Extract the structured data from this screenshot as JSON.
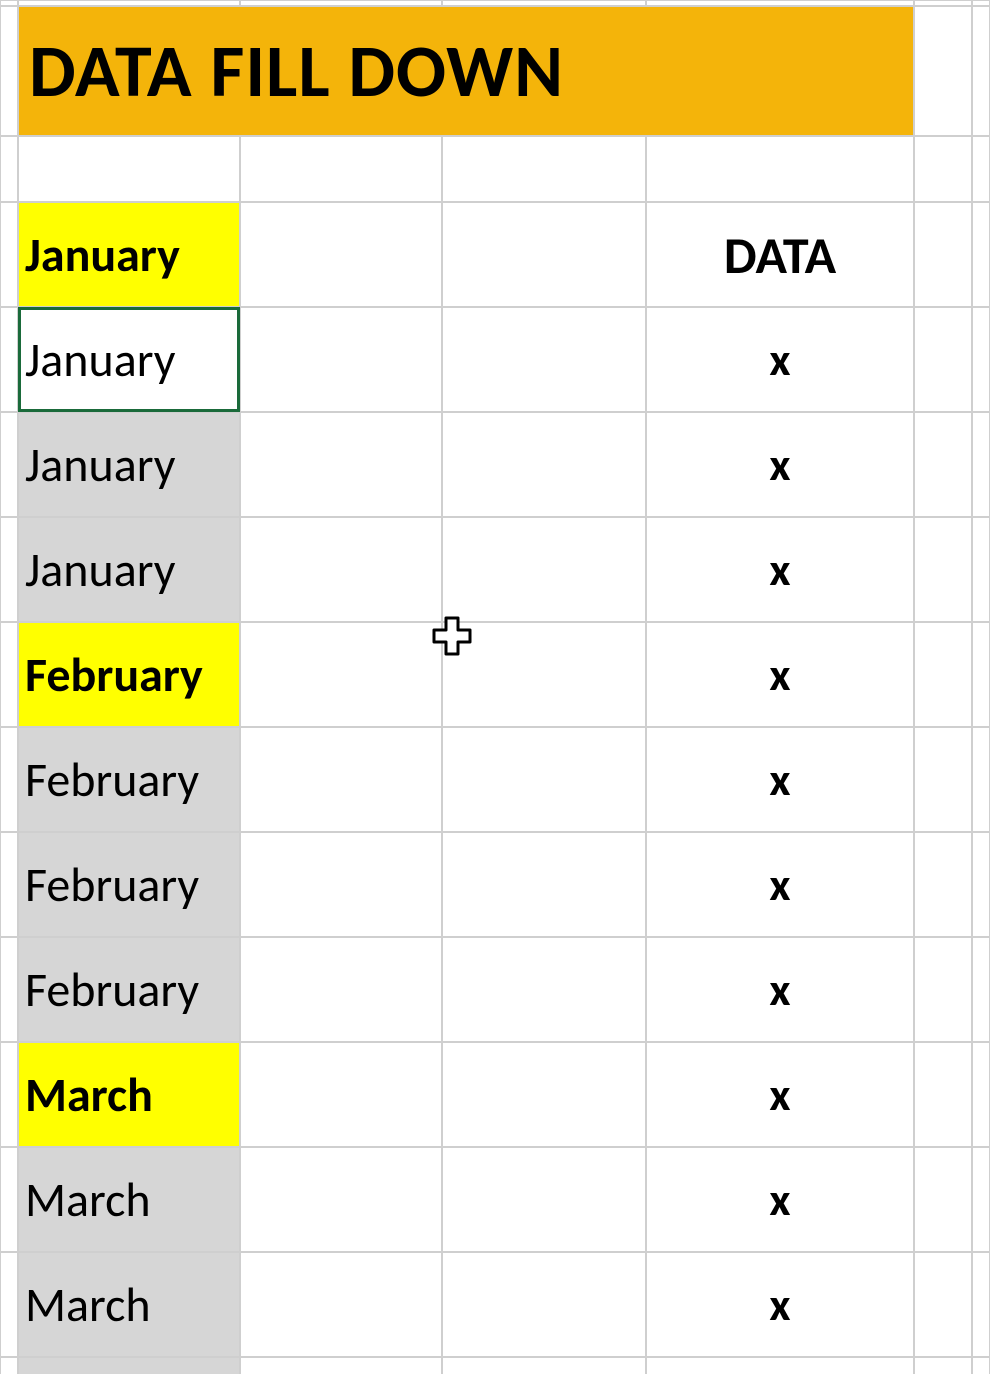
{
  "title": "DATA FILL DOWN",
  "header": {
    "data_col": "DATA"
  },
  "rows": [
    {
      "label": "January",
      "data": "",
      "style": "yellow-bold"
    },
    {
      "label": "January",
      "data": "x",
      "style": "active"
    },
    {
      "label": "January",
      "data": "x",
      "style": "grey"
    },
    {
      "label": "January",
      "data": "x",
      "style": "grey"
    },
    {
      "label": "February",
      "data": "x",
      "style": "yellow-bold"
    },
    {
      "label": "February",
      "data": "x",
      "style": "grey"
    },
    {
      "label": "February",
      "data": "x",
      "style": "grey"
    },
    {
      "label": "February",
      "data": "x",
      "style": "grey"
    },
    {
      "label": "March",
      "data": "x",
      "style": "yellow-bold"
    },
    {
      "label": "March",
      "data": "x",
      "style": "grey"
    },
    {
      "label": "March",
      "data": "x",
      "style": "grey"
    }
  ],
  "colors": {
    "title_bg": "#f4b40a",
    "highlight_bg": "#ffff00",
    "selection_bg": "#d6d6d6",
    "active_border": "#1a6a3a"
  },
  "cursor": "excel-select-cursor"
}
